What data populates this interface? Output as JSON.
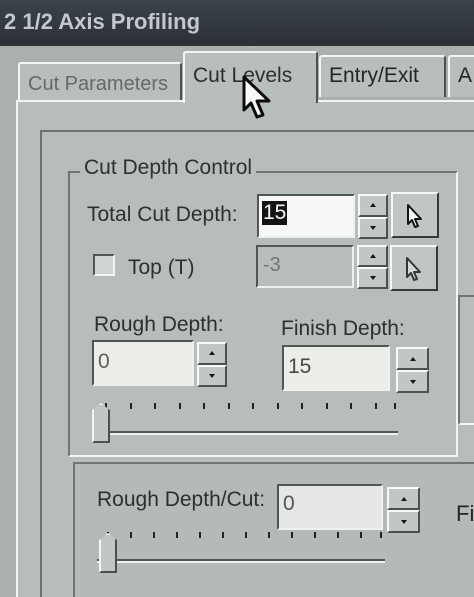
{
  "window": {
    "title": "2 1/2 Axis Profiling"
  },
  "tabs": [
    {
      "label": "Cut Parameters",
      "state": "inactive"
    },
    {
      "label": "Cut Levels",
      "state": "active"
    },
    {
      "label": "Entry/Exit",
      "state": "inactive"
    },
    {
      "label": "A",
      "state": "partially visible"
    }
  ],
  "cut_depth_control": {
    "title": "Cut Depth Control",
    "total_cut_depth": {
      "label": "Total Cut Depth:",
      "value": "15"
    },
    "top": {
      "label": "Top (T)",
      "checked": false,
      "value": "-3"
    },
    "rough_depth": {
      "label": "Rough Depth:",
      "value": "0",
      "slider_level": 0
    },
    "finish_depth": {
      "label": "Finish Depth:",
      "value": "15"
    }
  },
  "rough_depth_per_cut": {
    "label": "Rough Depth/Cut:",
    "value": "0",
    "slider_level": 0
  },
  "partial_right_label": "Fi",
  "icons": {
    "pick_tool": "pointer-arrow",
    "mouse_cursor": "pointer-arrow"
  }
}
